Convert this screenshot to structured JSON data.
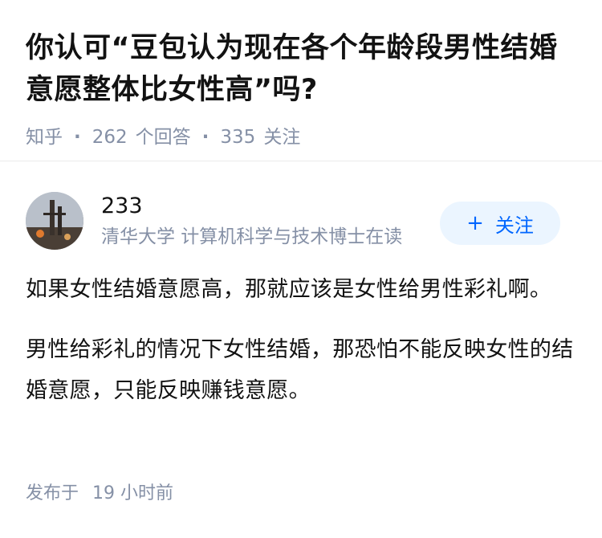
{
  "question": {
    "title": "你认可“豆包认为现在各个年龄段男性结婚意愿整体比女性高”吗?",
    "site": "知乎",
    "answers_count": "262",
    "answers_label": "个回答",
    "followers_count": "335",
    "followers_label": "关注"
  },
  "answer": {
    "author": {
      "name": "233",
      "headline": "清华大学 计算机科学与技术博士在读",
      "avatar_icon": "avatar-image"
    },
    "follow_button": {
      "icon": "plus-icon",
      "icon_glyph": "+",
      "label": "关注"
    },
    "paragraphs": [
      "如果女性结婚意愿高，那就应该是女性给男性彩礼啊。",
      "男性给彩礼的情况下女性结婚，那恐怕不能反映女性的结婚意愿，只能反映赚钱意愿。"
    ],
    "publish_label": "发布于",
    "publish_time": "19 小时前"
  },
  "colors": {
    "title": "#121212",
    "meta": "#8590a6",
    "accent": "#0066ff",
    "follow_bg": "#ebf5ff",
    "divider": "#ebebeb"
  }
}
